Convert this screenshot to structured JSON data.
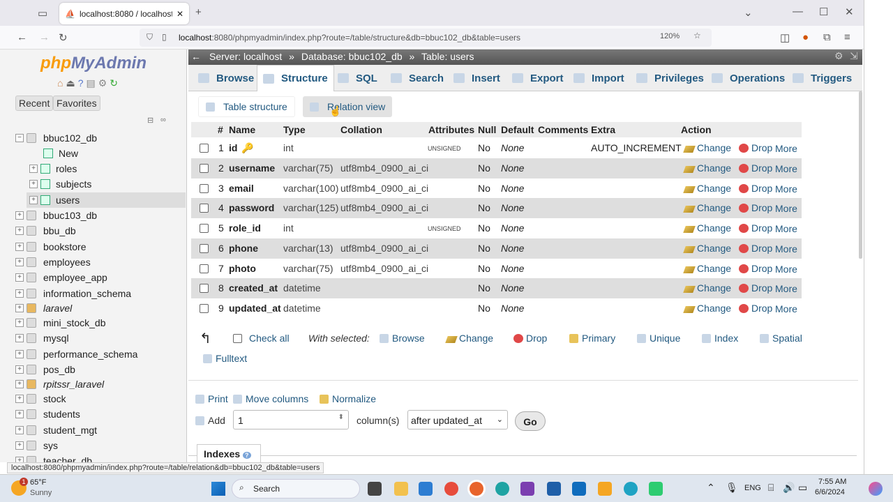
{
  "browser": {
    "tab_title": "localhost:8080 / localhost / bbu",
    "url_host": "localhost",
    "url_rest": ":8080/phpmyadmin/index.php?route=/table/structure&db=bbuc102_db&table=users",
    "zoom": "120%",
    "status_url": "localhost:8080/phpmyadmin/index.php?route=/table/relation&db=bbuc102_db&table=users"
  },
  "sidebar": {
    "logo_php": "php",
    "logo_my": "MyAdmin",
    "recent": "Recent",
    "favorites": "Favorites",
    "tree": [
      {
        "label": "bbuc102_db",
        "expander": "−"
      },
      {
        "label": "New"
      },
      {
        "label": "roles",
        "expander": "+"
      },
      {
        "label": "subjects",
        "expander": "+"
      },
      {
        "label": "users",
        "expander": "+"
      },
      {
        "label": "bbuc103_db",
        "expander": "+"
      },
      {
        "label": "bbu_db",
        "expander": "+"
      },
      {
        "label": "bookstore",
        "expander": "+"
      },
      {
        "label": "employees",
        "expander": "+"
      },
      {
        "label": "employee_app",
        "expander": "+"
      },
      {
        "label": "information_schema",
        "expander": "+"
      },
      {
        "label": "laravel",
        "expander": "+"
      },
      {
        "label": "mini_stock_db",
        "expander": "+"
      },
      {
        "label": "mysql",
        "expander": "+"
      },
      {
        "label": "performance_schema",
        "expander": "+"
      },
      {
        "label": "pos_db",
        "expander": "+"
      },
      {
        "label": "rpitssr_laravel",
        "expander": "+"
      },
      {
        "label": "stock",
        "expander": "+"
      },
      {
        "label": "students",
        "expander": "+"
      },
      {
        "label": "student_mgt",
        "expander": "+"
      },
      {
        "label": "sys",
        "expander": "+"
      },
      {
        "label": "teacher_db",
        "expander": "+"
      }
    ]
  },
  "breadcrumb": {
    "server": "Server: localhost",
    "database": "Database: bbuc102_db",
    "table": "Table: users",
    "sep": "»"
  },
  "tabs": [
    "Browse",
    "Structure",
    "SQL",
    "Search",
    "Insert",
    "Export",
    "Import",
    "Privileges",
    "Operations",
    "Triggers"
  ],
  "subtabs": {
    "table_structure": "Table structure",
    "relation_view": "Relation view"
  },
  "columns": {
    "num": "#",
    "name": "Name",
    "type": "Type",
    "collation": "Collation",
    "attributes": "Attributes",
    "null": "Null",
    "default": "Default",
    "comments": "Comments",
    "extra": "Extra",
    "action": "Action"
  },
  "rows": [
    {
      "num": "1",
      "name": "id",
      "type": "int",
      "collation": "",
      "attributes": "UNSIGNED",
      "null": "No",
      "default": "None",
      "extra": "AUTO_INCREMENT"
    },
    {
      "num": "2",
      "name": "username",
      "type": "varchar(75)",
      "collation": "utf8mb4_0900_ai_ci",
      "attributes": "",
      "null": "No",
      "default": "None",
      "extra": ""
    },
    {
      "num": "3",
      "name": "email",
      "type": "varchar(100)",
      "collation": "utf8mb4_0900_ai_ci",
      "attributes": "",
      "null": "No",
      "default": "None",
      "extra": ""
    },
    {
      "num": "4",
      "name": "password",
      "type": "varchar(125)",
      "collation": "utf8mb4_0900_ai_ci",
      "attributes": "",
      "null": "No",
      "default": "None",
      "extra": ""
    },
    {
      "num": "5",
      "name": "role_id",
      "type": "int",
      "collation": "",
      "attributes": "UNSIGNED",
      "null": "No",
      "default": "None",
      "extra": ""
    },
    {
      "num": "6",
      "name": "phone",
      "type": "varchar(13)",
      "collation": "utf8mb4_0900_ai_ci",
      "attributes": "",
      "null": "No",
      "default": "None",
      "extra": ""
    },
    {
      "num": "7",
      "name": "photo",
      "type": "varchar(75)",
      "collation": "utf8mb4_0900_ai_ci",
      "attributes": "",
      "null": "No",
      "default": "None",
      "extra": ""
    },
    {
      "num": "8",
      "name": "created_at",
      "type": "datetime",
      "collation": "",
      "attributes": "",
      "null": "No",
      "default": "None",
      "extra": ""
    },
    {
      "num": "9",
      "name": "updated_at",
      "type": "datetime",
      "collation": "",
      "attributes": "",
      "null": "No",
      "default": "None",
      "extra": ""
    }
  ],
  "actions": {
    "change": "Change",
    "drop": "Drop",
    "more": "More"
  },
  "footer": {
    "check_all": "Check all",
    "with_selected": "With selected:",
    "browse": "Browse",
    "change": "Change",
    "drop": "Drop",
    "primary": "Primary",
    "unique": "Unique",
    "index": "Index",
    "spatial": "Spatial",
    "fulltext": "Fulltext",
    "print": "Print",
    "move_columns": "Move columns",
    "normalize": "Normalize",
    "add": "Add",
    "add_count": "1",
    "columns_label": "column(s)",
    "position": "after updated_at",
    "go": "Go",
    "indexes": "Indexes"
  },
  "taskbar": {
    "temp": "65°F",
    "weather": "Sunny",
    "search": "Search",
    "lang": "ENG",
    "time": "7:55 AM",
    "date": "6/6/2024",
    "badge": "1"
  }
}
